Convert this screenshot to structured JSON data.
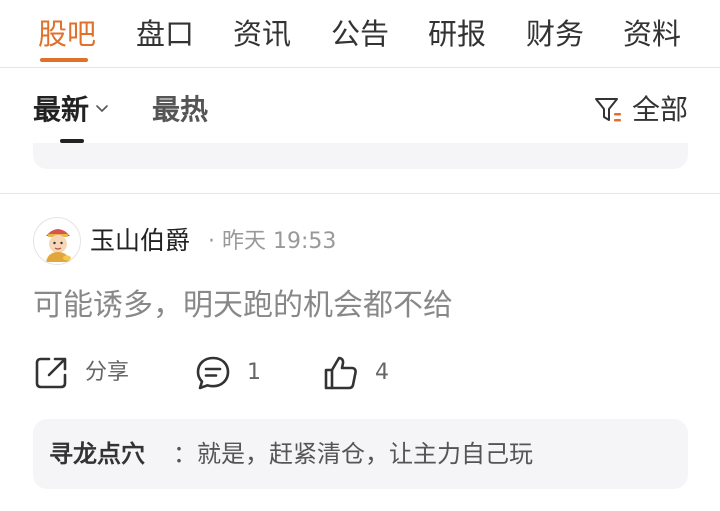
{
  "tabs": [
    {
      "label": "股吧",
      "active": true
    },
    {
      "label": "盘口"
    },
    {
      "label": "资讯"
    },
    {
      "label": "公告"
    },
    {
      "label": "研报"
    },
    {
      "label": "财务"
    },
    {
      "label": "资料"
    }
  ],
  "sort": {
    "latest_label": "最新",
    "hot_label": "最热",
    "filter_label": "全部",
    "filter_icon": "filter-icon"
  },
  "post": {
    "author": "玉山伯爵",
    "separator": "·",
    "time": "昨天 19:53",
    "text": "可能诱多，明天跑的机会都不给",
    "share_label": "分享",
    "comment_count": "1",
    "like_count": "4",
    "reply": {
      "author": "寻龙点穴",
      "text": "：就是，赶紧清仓，让主力自己玩"
    }
  },
  "colors": {
    "accent": "#e0712a",
    "text": "#222222",
    "muted": "#999999",
    "reply_bg": "#f5f5f7"
  }
}
